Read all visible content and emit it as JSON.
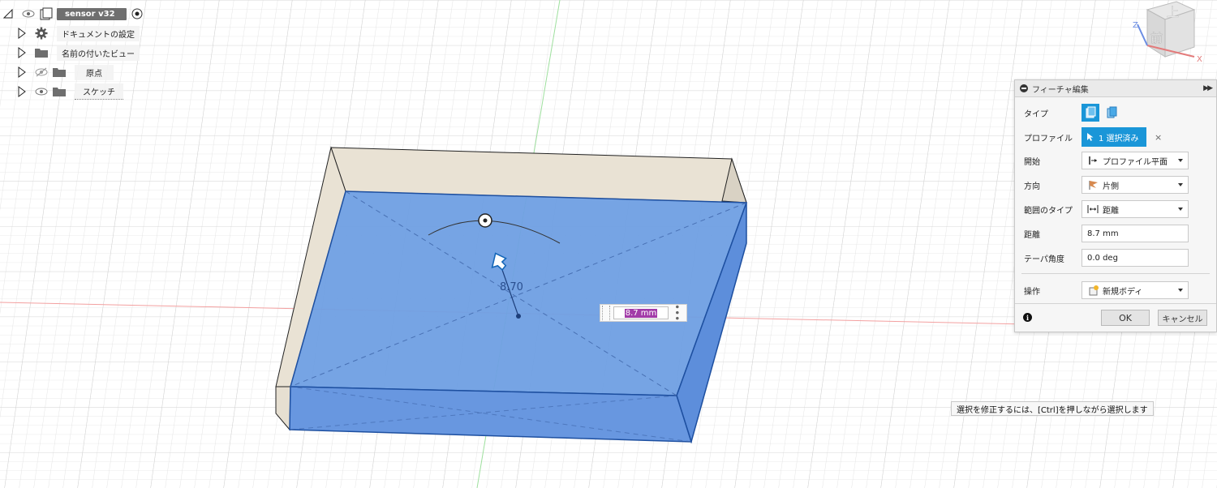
{
  "browser": {
    "root": {
      "label": "sensor v32"
    },
    "items": [
      {
        "label": "ドキュメントの設定"
      },
      {
        "label": "名前の付いたビュー"
      },
      {
        "label": "原点"
      },
      {
        "label": "スケッチ"
      }
    ]
  },
  "viewcube": {
    "top_label": "上",
    "front_label": "前",
    "x_axis": "X",
    "z_axis": "Z"
  },
  "canvas": {
    "dimension_label": "8.70",
    "distance_input_value": "8.7 mm"
  },
  "panel": {
    "title": "フィーチャ編集",
    "rows": {
      "type": {
        "label": "タイプ"
      },
      "profile": {
        "label": "プロファイル",
        "selection": "1 選択済み",
        "clear": "×"
      },
      "start": {
        "label": "開始",
        "value": "プロファイル平面"
      },
      "direction": {
        "label": "方向",
        "value": "片側"
      },
      "extent_type": {
        "label": "範囲のタイプ",
        "value": "距離"
      },
      "distance": {
        "label": "距離",
        "value": "8.7 mm"
      },
      "taper": {
        "label": "テーパ角度",
        "value": "0.0 deg"
      },
      "operation": {
        "label": "操作",
        "value": "新規ボディ"
      }
    },
    "ok_label": "OK",
    "cancel_label": "キャンセル"
  },
  "tooltip": {
    "text": "選択を修正するには、[Ctrl]を押しながら選択します"
  },
  "colors": {
    "accent": "#1a96d8",
    "body_face": "#e8e0d0",
    "selected_face": "#6f9fe3",
    "grid_line": "#e2e2e2",
    "x_axis_line": "#f08a8a",
    "y_axis_line": "#8fd88f"
  }
}
